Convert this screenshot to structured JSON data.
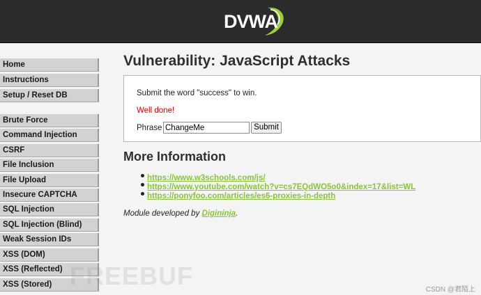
{
  "header": {
    "logo_text": "DVWA"
  },
  "sidebar": {
    "items": [
      {
        "label": "Home"
      },
      {
        "label": "Instructions"
      },
      {
        "label": "Setup / Reset DB"
      },
      {
        "label": "Brute Force"
      },
      {
        "label": "Command Injection"
      },
      {
        "label": "CSRF"
      },
      {
        "label": "File Inclusion"
      },
      {
        "label": "File Upload"
      },
      {
        "label": "Insecure CAPTCHA"
      },
      {
        "label": "SQL Injection"
      },
      {
        "label": "SQL Injection (Blind)"
      },
      {
        "label": "Weak Session IDs"
      },
      {
        "label": "XSS (DOM)"
      },
      {
        "label": "XSS (Reflected)"
      },
      {
        "label": "XSS (Stored)"
      }
    ]
  },
  "main": {
    "title": "Vulnerability: JavaScript Attacks",
    "instruction": "Submit the word \"success\" to win.",
    "status": "Well done!",
    "phrase_label": "Phrase",
    "phrase_value": "ChangeMe",
    "submit_label": "Submit",
    "more_title": "More Information",
    "links": [
      {
        "text": "https://www.w3schools.com/js/"
      },
      {
        "text": "https://www.youtube.com/watch?v=cs7EQdWO5o0&index=17&list=WL"
      },
      {
        "text": "https://ponyfoo.com/articles/es6-proxies-in-depth"
      }
    ],
    "credit_prefix": "Module developed by ",
    "credit_author": "Digininja",
    "credit_suffix": "."
  },
  "watermarks": {
    "freebuf": "FREEBUF",
    "csdn": "CSDN @君陌上"
  },
  "colors": {
    "header_bg": "#2b2b2b",
    "link_green": "#87c536",
    "status_red": "#e20000",
    "nav_bg": "#d2d2d2",
    "page_bg": "#f4f4f4"
  }
}
